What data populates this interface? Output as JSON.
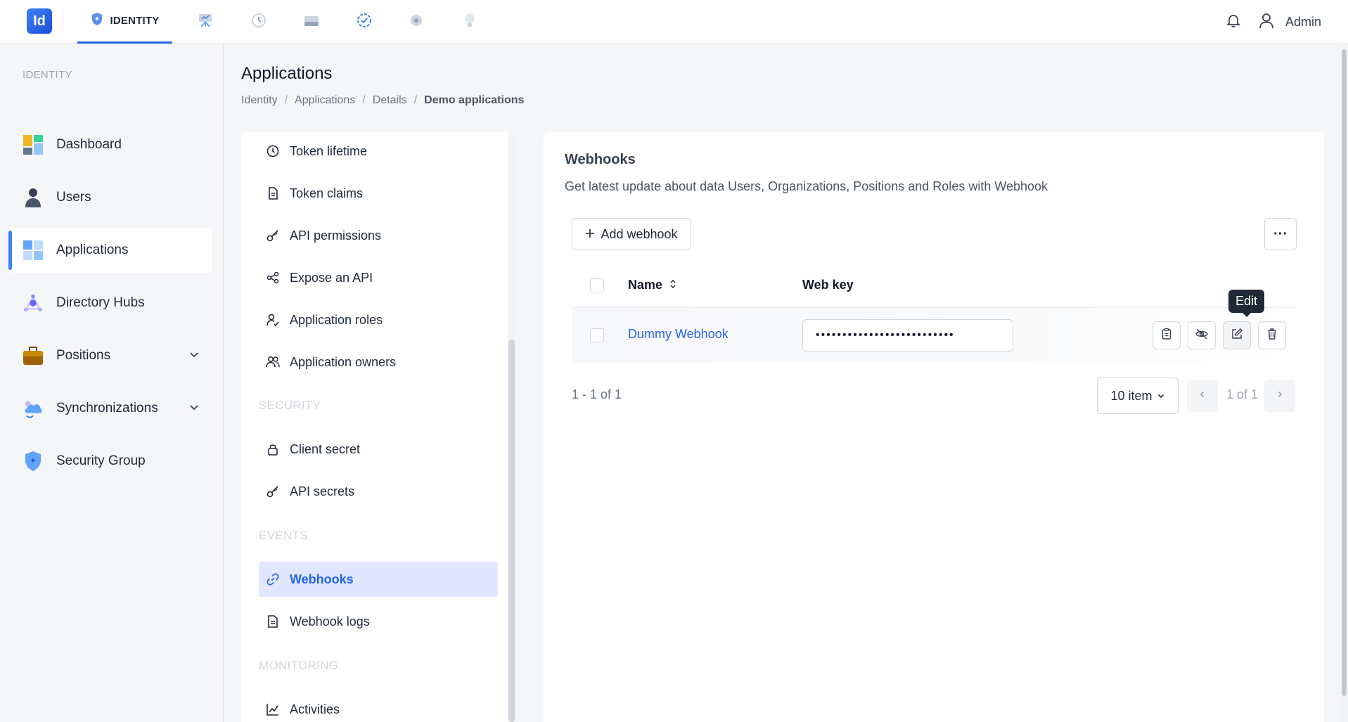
{
  "topbar": {
    "logo": "Id",
    "active_tab": "IDENTITY",
    "tabs": [
      {
        "name": "identity",
        "icon": "shield-icon"
      },
      {
        "name": "presentation",
        "icon": "presentation-icon"
      },
      {
        "name": "history",
        "icon": "history-icon"
      },
      {
        "name": "storage",
        "icon": "drive-icon"
      },
      {
        "name": "verified",
        "icon": "badge-check-icon"
      },
      {
        "name": "settings",
        "icon": "gear-icon"
      },
      {
        "name": "ideas",
        "icon": "lightbulb-icon"
      }
    ],
    "user": "Admin"
  },
  "sidebar": {
    "section": "IDENTITY",
    "items": [
      {
        "label": "Dashboard",
        "icon": "dashboard-icon"
      },
      {
        "label": "Users",
        "icon": "user-icon"
      },
      {
        "label": "Applications",
        "icon": "applications-icon",
        "active": true
      },
      {
        "label": "Directory Hubs",
        "icon": "hub-icon"
      },
      {
        "label": "Positions",
        "icon": "briefcase-icon",
        "expandable": true
      },
      {
        "label": "Synchronizations",
        "icon": "cloud-sync-icon",
        "expandable": true
      },
      {
        "label": "Security Group",
        "icon": "shield-icon"
      }
    ]
  },
  "page": {
    "title": "Applications",
    "breadcrumb": [
      "Identity",
      "Applications",
      "Details",
      "Demo applications"
    ],
    "separator": "/"
  },
  "menu": {
    "items_top": [
      {
        "label": "Token lifetime",
        "icon": "clock-icon"
      },
      {
        "label": "Token claims",
        "icon": "document-icon"
      },
      {
        "label": "API permissions",
        "icon": "key-icon"
      },
      {
        "label": "Expose an API",
        "icon": "share-icon"
      },
      {
        "label": "Application roles",
        "icon": "user-role-icon"
      },
      {
        "label": "Application owners",
        "icon": "users-icon"
      }
    ],
    "security_section": "SECURITY",
    "security_items": [
      {
        "label": "Client secret",
        "icon": "lock-icon"
      },
      {
        "label": "API secrets",
        "icon": "key-icon"
      }
    ],
    "events_section": "EVENTS",
    "events_items": [
      {
        "label": "Webhooks",
        "icon": "link-icon",
        "active": true
      },
      {
        "label": "Webhook logs",
        "icon": "file-list-icon"
      }
    ],
    "monitoring_section": "MONITORING",
    "monitoring_items": [
      {
        "label": "Activities",
        "icon": "chart-line-icon"
      }
    ]
  },
  "content": {
    "title": "Webhooks",
    "description": "Get latest update about data Users, Organizations, Positions and Roles with Webhook",
    "add_button": "Add webhook",
    "more_button": "···",
    "table": {
      "columns": [
        "Name",
        "Web key"
      ],
      "rows": [
        {
          "name": "Dummy Webhook",
          "web_key": "••••••••••••••••••••••••••"
        }
      ]
    },
    "tooltip": "Edit",
    "pagination": {
      "info": "1 - 1 of 1",
      "page_size": "10 item",
      "current": "1 of 1"
    }
  },
  "colors": {
    "accent": "#2563eb",
    "active_bg": "#e0e7ff"
  }
}
